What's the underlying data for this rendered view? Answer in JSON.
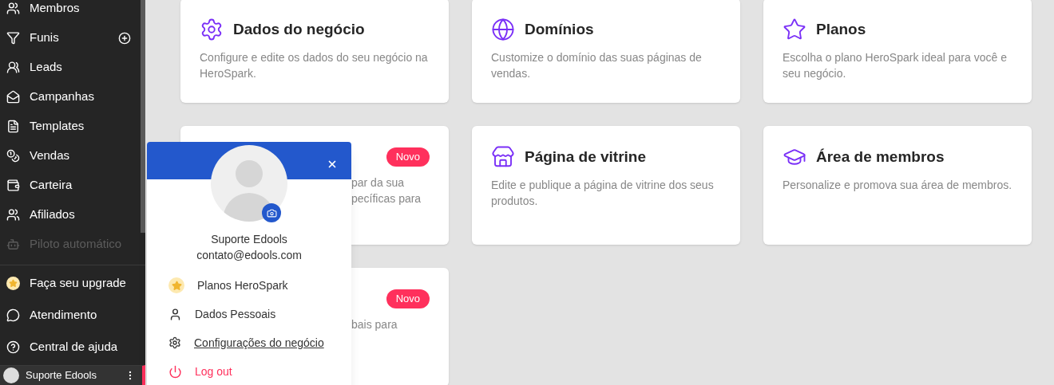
{
  "sidebar": {
    "items": [
      {
        "label": "Membros",
        "add_button": false,
        "disabled": false
      },
      {
        "label": "Funis",
        "add_button": true,
        "disabled": false
      },
      {
        "label": "Leads",
        "add_button": false,
        "disabled": false
      },
      {
        "label": "Campanhas",
        "add_button": false,
        "disabled": false
      },
      {
        "label": "Templates",
        "add_button": false,
        "disabled": false
      },
      {
        "label": "Vendas",
        "add_button": false,
        "disabled": false
      },
      {
        "label": "Carteira",
        "add_button": false,
        "disabled": false
      },
      {
        "label": "Afiliados",
        "add_button": false,
        "disabled": false
      },
      {
        "label": "Piloto automático",
        "add_button": false,
        "disabled": true
      }
    ],
    "bottom_items": [
      {
        "label": "Faça seu upgrade"
      },
      {
        "label": "Atendimento"
      },
      {
        "label": "Central de ajuda"
      }
    ],
    "user": {
      "name": "Suporte Edools"
    }
  },
  "cards": [
    {
      "kind": "full",
      "title": "Dados do negócio",
      "description": "Configure e edite os dados do seu negócio na HeroSpark."
    },
    {
      "kind": "full",
      "title": "Domínios",
      "description": "Customize o domínio das suas páginas de vendas."
    },
    {
      "kind": "full",
      "title": "Planos",
      "description": "Escolha o plano HeroSpark ideal para você e seu negócio."
    },
    {
      "kind": "covered",
      "badge": "Novo",
      "lines": [
        "par da sua",
        "pecíficas para"
      ]
    },
    {
      "kind": "full",
      "title": "Página de vitrine",
      "description": "Edite e publique a página de vitrine dos seus produtos."
    },
    {
      "kind": "full",
      "title": "Área de membros",
      "description": "Personalize e promova sua área de membros."
    },
    {
      "kind": "covered",
      "badge": "Novo",
      "lines": [
        "bais para"
      ]
    }
  ],
  "profile_popup": {
    "name": "Suporte Edools",
    "email": "contato@edools.com",
    "menu": [
      {
        "kind": "plans",
        "label": "Planos HeroSpark",
        "hovered": false
      },
      {
        "kind": "personal",
        "label": "Dados Pessoais",
        "hovered": false
      },
      {
        "kind": "business",
        "label": "Configurações do negócio",
        "hovered": true
      },
      {
        "kind": "logout",
        "label": "Log out",
        "hovered": false
      }
    ]
  }
}
